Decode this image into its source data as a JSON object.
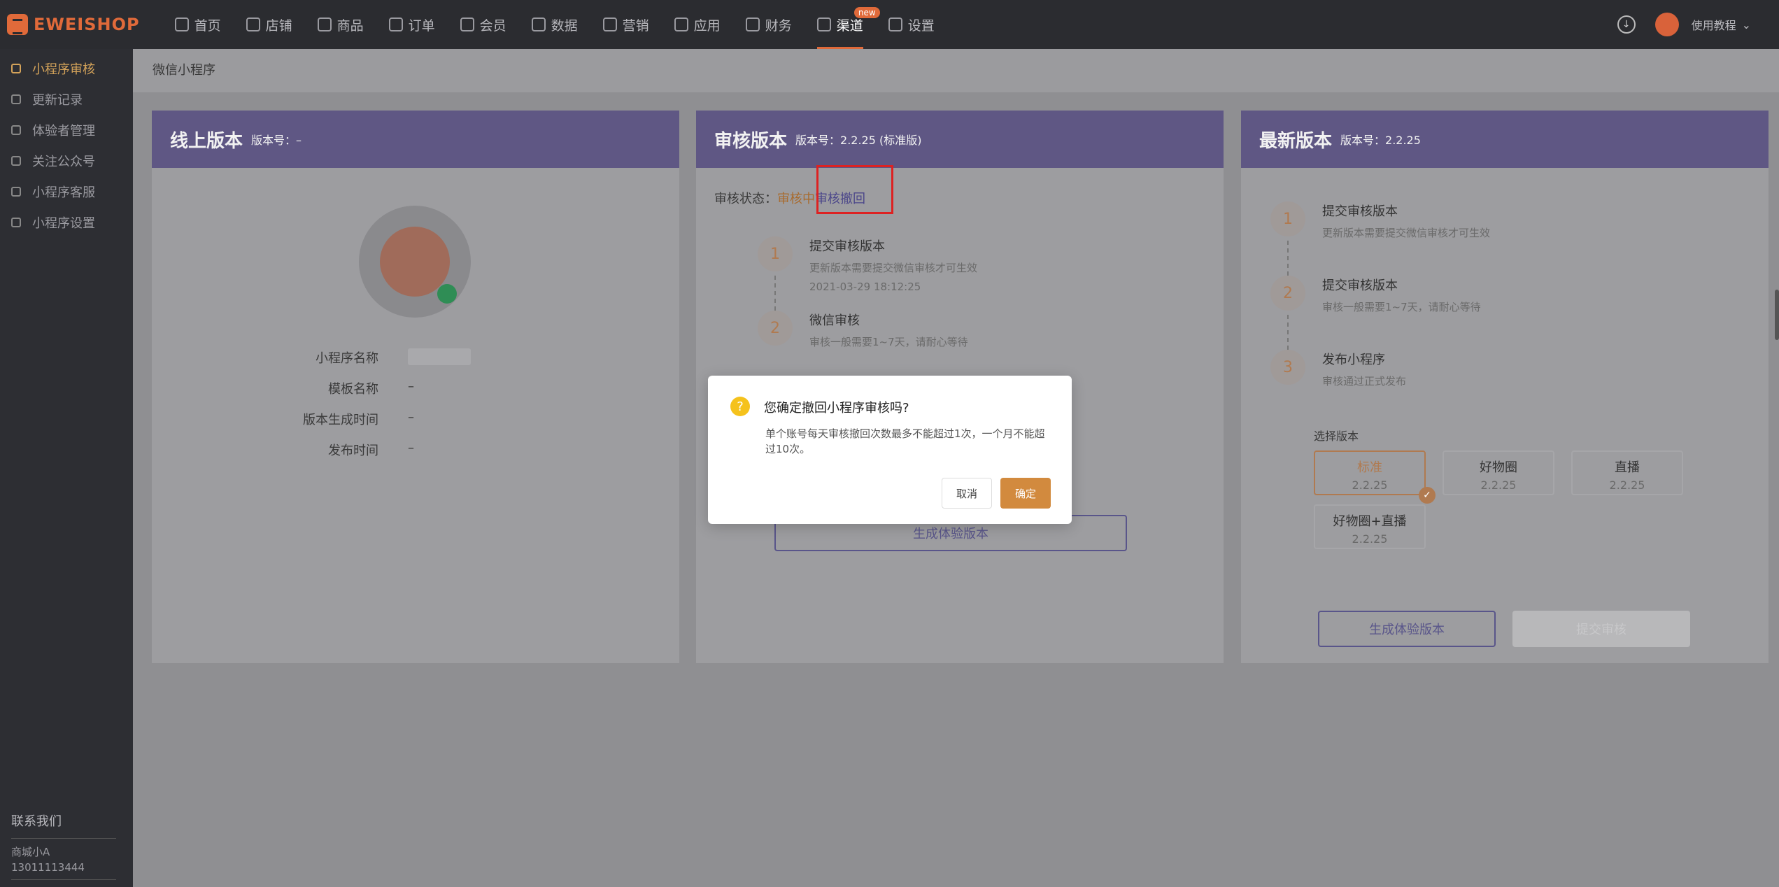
{
  "brand": {
    "name": "EWEISHOP"
  },
  "nav": [
    {
      "label": "首页",
      "icon": "home-icon"
    },
    {
      "label": "店铺",
      "icon": "store-icon"
    },
    {
      "label": "商品",
      "icon": "goods-icon"
    },
    {
      "label": "订单",
      "icon": "order-icon"
    },
    {
      "label": "会员",
      "icon": "member-icon"
    },
    {
      "label": "数据",
      "icon": "chart-icon"
    },
    {
      "label": "营销",
      "icon": "tag-icon"
    },
    {
      "label": "应用",
      "icon": "app-icon"
    },
    {
      "label": "财务",
      "icon": "finance-icon"
    },
    {
      "label": "渠道",
      "icon": "channel-icon",
      "badge": "new"
    },
    {
      "label": "设置",
      "icon": "gear-icon"
    }
  ],
  "topright": {
    "help": "使用教程"
  },
  "sidebar": {
    "items": [
      {
        "label": "小程序审核"
      },
      {
        "label": "更新记录"
      },
      {
        "label": "体验者管理"
      },
      {
        "label": "关注公众号"
      },
      {
        "label": "小程序客服"
      },
      {
        "label": "小程序设置"
      }
    ],
    "contact_title": "联系我们",
    "contact_name": "商城小A",
    "contact_phone": "13011113444"
  },
  "breadcrumb": "微信小程序",
  "online": {
    "title": "线上版本",
    "version": "版本号：–",
    "fields": [
      {
        "k": "小程序名称",
        "v": ""
      },
      {
        "k": "模板名称",
        "v": "–"
      },
      {
        "k": "版本生成时间",
        "v": "–"
      },
      {
        "k": "发布时间",
        "v": "–"
      }
    ]
  },
  "review": {
    "title": "审核版本",
    "version": "版本号：2.2.25 (标准版)",
    "status_label": "审核状态：",
    "status": "审核中",
    "revoke": "审核撤回",
    "steps": [
      {
        "n": "1",
        "t": "提交审核版本",
        "d": "更新版本需要提交微信审核才可生效",
        "time": "2021-03-29 18:12:25"
      },
      {
        "n": "2",
        "t": "微信审核",
        "d": "审核一般需要1~7天，请耐心等待"
      }
    ],
    "gen_btn": "生成体验版本"
  },
  "latest": {
    "title": "最新版本",
    "version": "版本号：2.2.25",
    "steps": [
      {
        "n": "1",
        "t": "提交审核版本",
        "d": "更新版本需要提交微信审核才可生效"
      },
      {
        "n": "2",
        "t": "提交审核版本",
        "d": "审核一般需要1~7天，请耐心等待"
      },
      {
        "n": "3",
        "t": "发布小程序",
        "d": "审核通过正式发布"
      }
    ],
    "select_label": "选择版本",
    "options": [
      {
        "name": "标准",
        "ver": "2.2.25",
        "selected": true
      },
      {
        "name": "好物圈",
        "ver": "2.2.25"
      },
      {
        "name": "直播",
        "ver": "2.2.25"
      },
      {
        "name": "好物圈+直播",
        "ver": "2.2.25"
      }
    ],
    "gen_btn": "生成体验版本",
    "submit_btn": "提交审核"
  },
  "modal": {
    "title": "您确定撤回小程序审核吗?",
    "text": "单个账号每天审核撤回次数最多不能超过1次，一个月不能超过10次。",
    "cancel": "取消",
    "ok": "确定"
  }
}
